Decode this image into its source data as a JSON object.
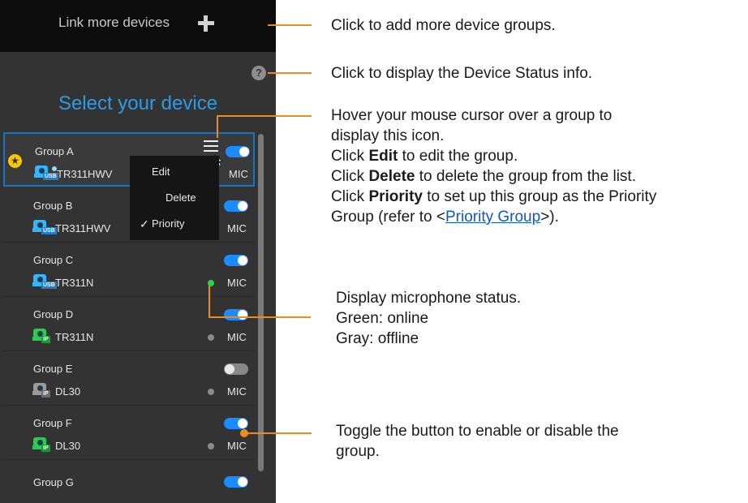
{
  "panel": {
    "link_more_label": "Link more devices",
    "select_title": "Select your device",
    "help_symbol": "?",
    "groups": [
      {
        "name": "Group A",
        "model": "TR311HWV",
        "mic_label": "MIC",
        "icon": "usb-camera-icon",
        "icon_tag": "USB",
        "toggle": "on",
        "selected": true,
        "priority": true
      },
      {
        "name": "Group B",
        "model": "TR311HWV",
        "mic_label": "MIC",
        "icon": "usb-camera-icon",
        "icon_tag": "USB",
        "toggle": "on"
      },
      {
        "name": "Group C",
        "model": "TR311N",
        "mic_label": "MIC",
        "icon": "usb-camera-icon",
        "icon_tag": "USB",
        "toggle": "on",
        "mic_status": "online"
      },
      {
        "name": "Group D",
        "model": "TR311N",
        "mic_label": "MIC",
        "icon": "ip-camera-icon",
        "icon_tag": "IP",
        "toggle": "on",
        "mic_status": "offline"
      },
      {
        "name": "Group E",
        "model": "DL30",
        "mic_label": "MIC",
        "icon": "ip-camera-icon",
        "icon_tag": "IP",
        "toggle": "off",
        "mic_status": "offline"
      },
      {
        "name": "Group F",
        "model": "DL30",
        "mic_label": "MIC",
        "icon": "ip-camera-icon",
        "icon_tag": "IP",
        "toggle": "on",
        "mic_status": "offline"
      },
      {
        "name": "Group G",
        "toggle": "on"
      }
    ],
    "context_menu": {
      "items": [
        {
          "label": "Edit",
          "checked": false
        },
        {
          "label": "Delete",
          "checked": false
        },
        {
          "label": "Priority",
          "checked": true
        }
      ]
    }
  },
  "callouts": {
    "link_more": "Click to add more device groups.",
    "help": "Click to display the Device Status info.",
    "hover_line1": "Hover your mouse cursor over a group to",
    "hover_line2": "display this icon.",
    "edit_pre": "Click ",
    "edit_bold": "Edit",
    "edit_post": " to edit the group.",
    "delete_pre": "Click ",
    "delete_bold": "Delete",
    "delete_post": " to delete the group from the list.",
    "priority_pre": "Click ",
    "priority_bold": "Priority",
    "priority_post": " to set up this group as the Priority",
    "priority_line2_pre": "Group (refer to <",
    "priority_link": "Priority Group",
    "priority_line2_post": ">).",
    "mic_line1": "Display microphone status.",
    "mic_line2": "Green: online",
    "mic_line3": "Gray: offline",
    "toggle_line1": "Toggle the button to enable or disable the",
    "toggle_line2": "group."
  },
  "colors": {
    "accent_blue": "#2f9be6",
    "toggle_on": "#1a8cff",
    "mic_online": "#2bd54b",
    "mic_offline": "#8a8a8a",
    "leader_orange": "#ef8a1c"
  }
}
